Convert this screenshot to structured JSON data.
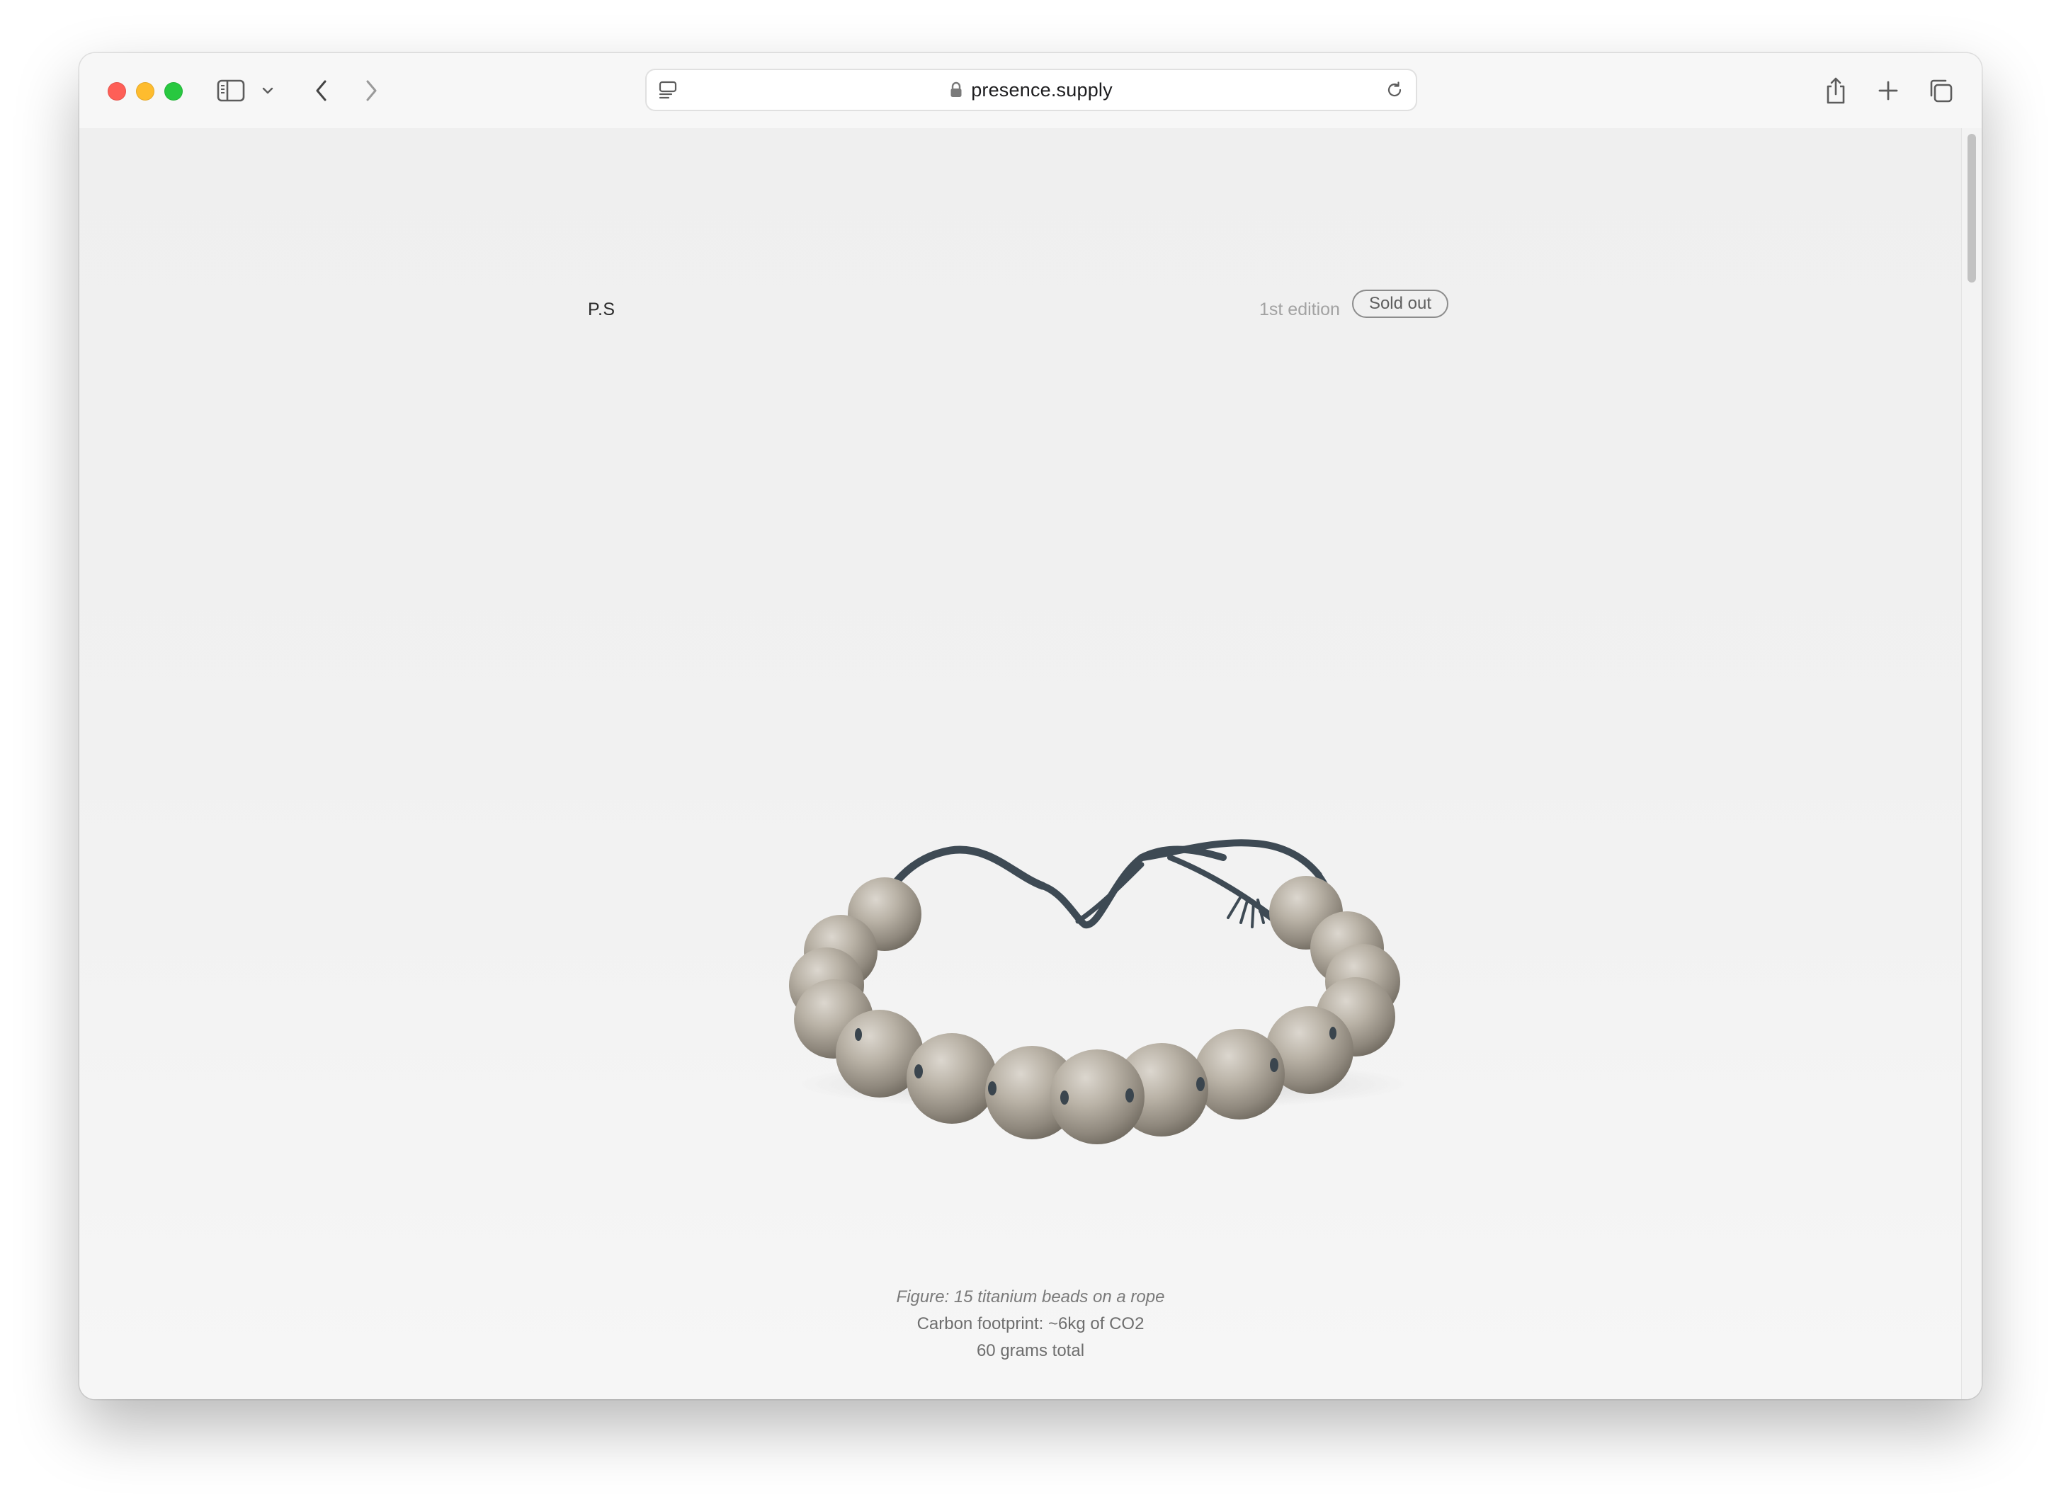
{
  "browser": {
    "url": "presence.supply",
    "icons": {
      "sidebar": "sidebar-icon",
      "back": "chevron-left-icon",
      "forward": "chevron-right-icon",
      "reader": "reader-icon",
      "lock": "lock-icon",
      "reload": "reload-icon",
      "share": "share-icon",
      "new_tab": "plus-icon",
      "tabs": "tab-overview-icon"
    }
  },
  "page": {
    "logo": "P.S",
    "edition": "1st edition",
    "status_badge": "Sold out",
    "product_image": "titanium bead bracelet on rope",
    "caption": {
      "figure": "Figure: 15 titanium beads on a rope",
      "footprint": "Carbon footprint: ~6kg of CO2",
      "weight": "60 grams total"
    }
  },
  "colors": {
    "traffic_red": "#fe5f57",
    "traffic_yellow": "#febc2e",
    "traffic_green": "#28c840",
    "page_background": "#f0f0f0",
    "bead": "#b5aea3",
    "rope": "#3e4a54"
  }
}
